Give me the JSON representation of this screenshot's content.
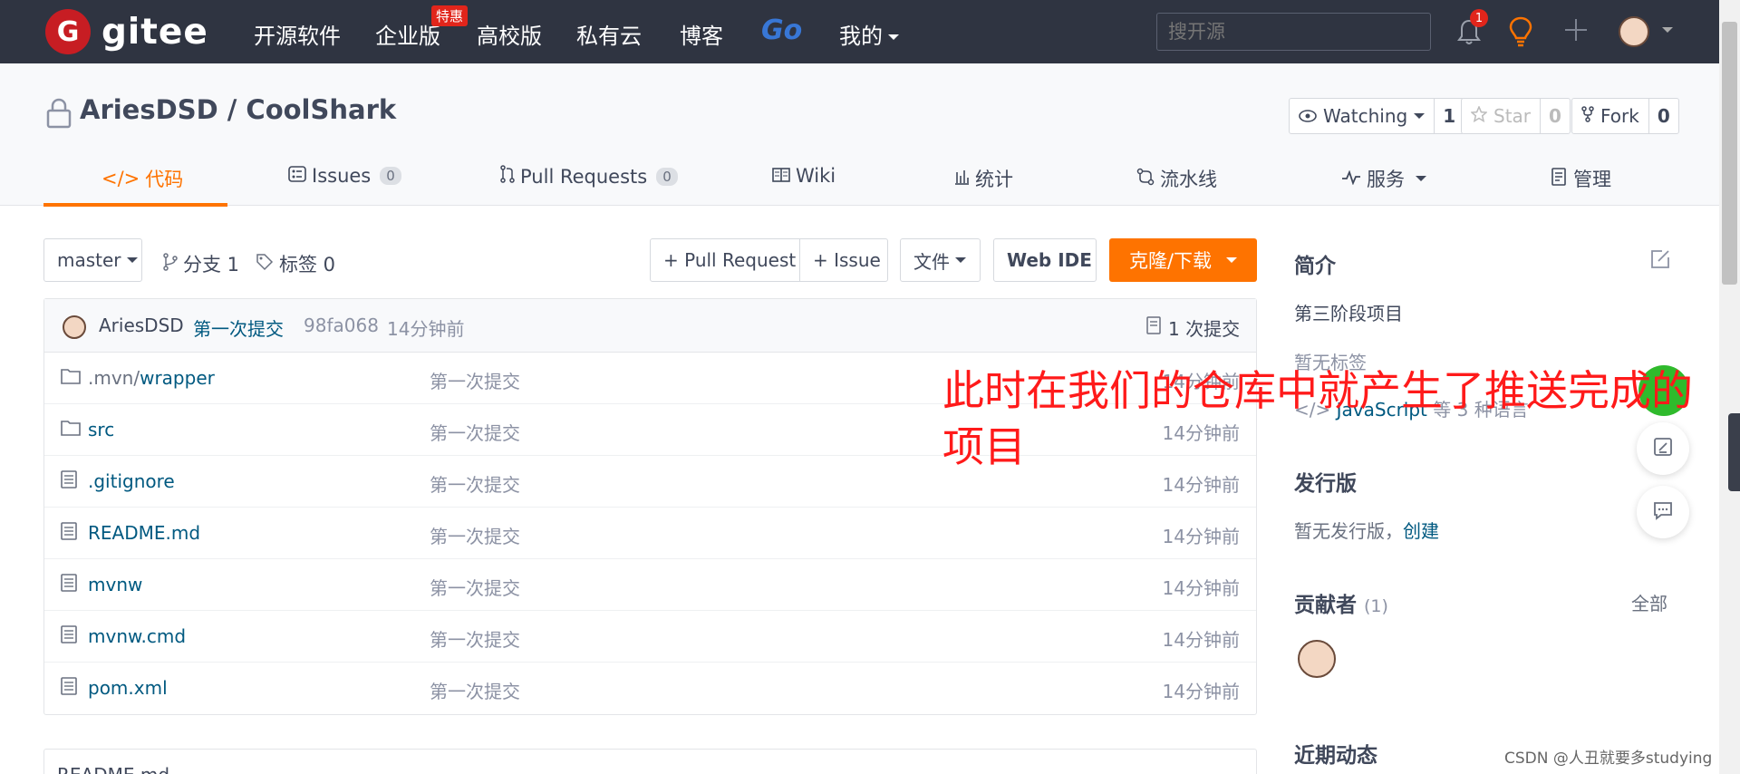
{
  "navbar": {
    "logo_letter": "G",
    "logo_text": "gitee",
    "items": [
      "开源软件",
      "企业版",
      "高校版",
      "私有云",
      "博客"
    ],
    "enterprise_badge": "特惠",
    "go_label": "Go",
    "mine_label": "我的",
    "search_placeholder": "搜开源",
    "notification_count": "1"
  },
  "repo": {
    "title": "AriesDSD / CoolShark",
    "watching_label": "Watching",
    "watching_count": "1",
    "star_label": "Star",
    "star_count": "0",
    "fork_label": "Fork",
    "fork_count": "0"
  },
  "tabs": [
    {
      "label": "代码"
    },
    {
      "label": "Issues",
      "count": "0"
    },
    {
      "label": "Pull Requests",
      "count": "0"
    },
    {
      "label": "Wiki"
    },
    {
      "label": "统计"
    },
    {
      "label": "流水线"
    },
    {
      "label": "服务"
    },
    {
      "label": "管理"
    }
  ],
  "toolbar": {
    "branch": "master",
    "branches_label": "分支 1",
    "tags_label": "标签 0",
    "pull_request_label": "+ Pull Request",
    "issue_label": "+ Issue",
    "file_label": "文件",
    "webide_label": "Web IDE",
    "clone_label": "克隆/下载"
  },
  "commit": {
    "author": "AriesDSD",
    "message": "第一次提交",
    "hash": "98fa068",
    "time": "14分钟前",
    "count_label": "1 次提交"
  },
  "files": [
    {
      "name_prefix": ".mvn/",
      "name": "wrapper",
      "type": "folder",
      "message": "第一次提交",
      "time": "14分钟前"
    },
    {
      "name_prefix": "",
      "name": "src",
      "type": "folder",
      "message": "第一次提交",
      "time": "14分钟前"
    },
    {
      "name_prefix": "",
      "name": ".gitignore",
      "type": "file",
      "message": "第一次提交",
      "time": "14分钟前"
    },
    {
      "name_prefix": "",
      "name": "README.md",
      "type": "file",
      "message": "第一次提交",
      "time": "14分钟前"
    },
    {
      "name_prefix": "",
      "name": "mvnw",
      "type": "file",
      "message": "第一次提交",
      "time": "14分钟前"
    },
    {
      "name_prefix": "",
      "name": "mvnw.cmd",
      "type": "file",
      "message": "第一次提交",
      "time": "14分钟前"
    },
    {
      "name_prefix": "",
      "name": "pom.xml",
      "type": "file",
      "message": "第一次提交",
      "time": "14分钟前"
    }
  ],
  "readme_label": "README.md",
  "sidebar": {
    "intro_title": "简介",
    "intro_text": "第三阶段项目",
    "no_tags": "暂无标签",
    "language_link": "JavaScript",
    "language_suffix": "等 3 种语言",
    "release_title": "发行版",
    "no_release": "暂无发行版，",
    "create_link": "创建",
    "contributors_title": "贡献者",
    "contributors_count": "(1)",
    "all_link": "全部",
    "activity_title": "近期动态"
  },
  "annotation": "此时在我们的仓库中就产生了推送完成的项目",
  "watermark": "CSDN @人丑就要多studying",
  "colors": {
    "navbar_bg": "#2f3441",
    "accent": "#fe7300",
    "link": "#005980",
    "logo_red": "#c71d23",
    "annotation_red": "#ff1a1a"
  }
}
